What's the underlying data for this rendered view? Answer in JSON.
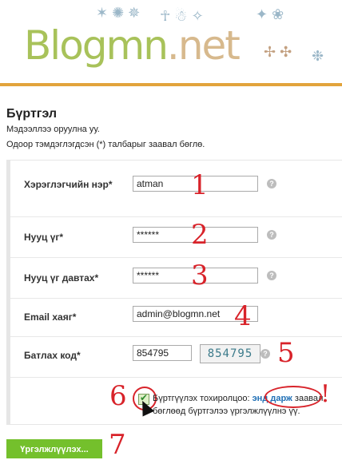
{
  "header": {
    "logo_left": "Blogmn",
    "logo_right": ".net"
  },
  "page": {
    "title": "Бүртгэл",
    "line1": "Мэдээллээ оруулна уу.",
    "line2": "Одоор тэмдэглэгдсэн (*) талбарыг заавал бөглө."
  },
  "form": {
    "username_label": "Хэрэглэгчийн нэр*",
    "username_value": "atman",
    "password_label": "Нууц үг*",
    "password_value": "******",
    "password_repeat_label": "Нууц үг давтах*",
    "password_repeat_value": "******",
    "email_label": "Email хаяг*",
    "email_value": "admin@blogmn.net",
    "captcha_label": "Батлах код*",
    "captcha_value": "854795",
    "captcha_image_text": "854795",
    "help_text": "?"
  },
  "agreement": {
    "prefix": "Бүртгүүлэх тохиролцоо:",
    "link": "энд дарж",
    "suffix": "заавал",
    "line2": "бөглөөд бүртгэлээ үргэлжлүүлнэ үү.",
    "checked": true
  },
  "annotations": {
    "n1": "1",
    "n2": "2",
    "n3": "3",
    "n4": "4",
    "n5": "5",
    "n6": "6",
    "n7": "7",
    "exclam": "!"
  },
  "button": {
    "continue": "Үргэлжлүүлэх..."
  },
  "colors": {
    "accent": "#e2a43c",
    "button": "#74c02c",
    "annotation": "#d8232a",
    "link": "#1f6fb5"
  },
  "icons": {
    "help": "question-mark-circle-icon",
    "checkbox": "checkmark-icon",
    "cursor": "mouse-pointer-icon"
  }
}
